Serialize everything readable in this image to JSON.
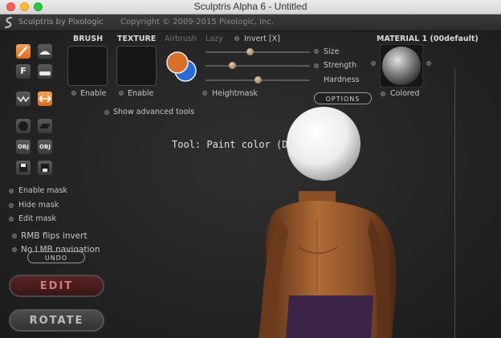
{
  "window": {
    "title": "Sculptris Alpha 6 - Untitled"
  },
  "header": {
    "app_name": "Sculptris by Pixologic",
    "copyright": "Copyright © 2009-2015 Pixologic, Inc."
  },
  "brush_panel": {
    "brush_label": "BRUSH",
    "texture_label": "TEXTURE",
    "brush_enable": "Enable",
    "texture_enable": "Enable",
    "airbrush": "Airbrush",
    "lazy": "Lazy",
    "invert": "Invert [X]",
    "size": "Size",
    "strength": "Strength",
    "hardness": "Hardness",
    "heightmask": "Heightmask",
    "show_advanced": "Show advanced tools",
    "options_button": "OPTIONS",
    "size_value": 0.42,
    "strength_value": 0.25,
    "hardness_value": 0.5,
    "primary_color": "#d9702a",
    "secondary_color": "#2a6bd8"
  },
  "material": {
    "title": "MATERIAL 1 (00default)",
    "colored": "Colored"
  },
  "tool_status": "Tool: Paint color (D)",
  "sidebar": {
    "tools": [
      "paint-brush",
      "bump",
      "flat-color",
      "mask-paint",
      "wave",
      "swap-arrows",
      "sphere",
      "plane",
      "obj-import",
      "obj-export",
      "save",
      "load"
    ],
    "enable_mask": "Enable mask",
    "hide_mask": "Hide mask",
    "edit_mask": "Edit mask",
    "rmb_flips": "RMB flips invert",
    "no_lmb": "No LMB navigation",
    "undo": "UNDO",
    "edit": "EDIT",
    "rotate": "ROTATE"
  }
}
